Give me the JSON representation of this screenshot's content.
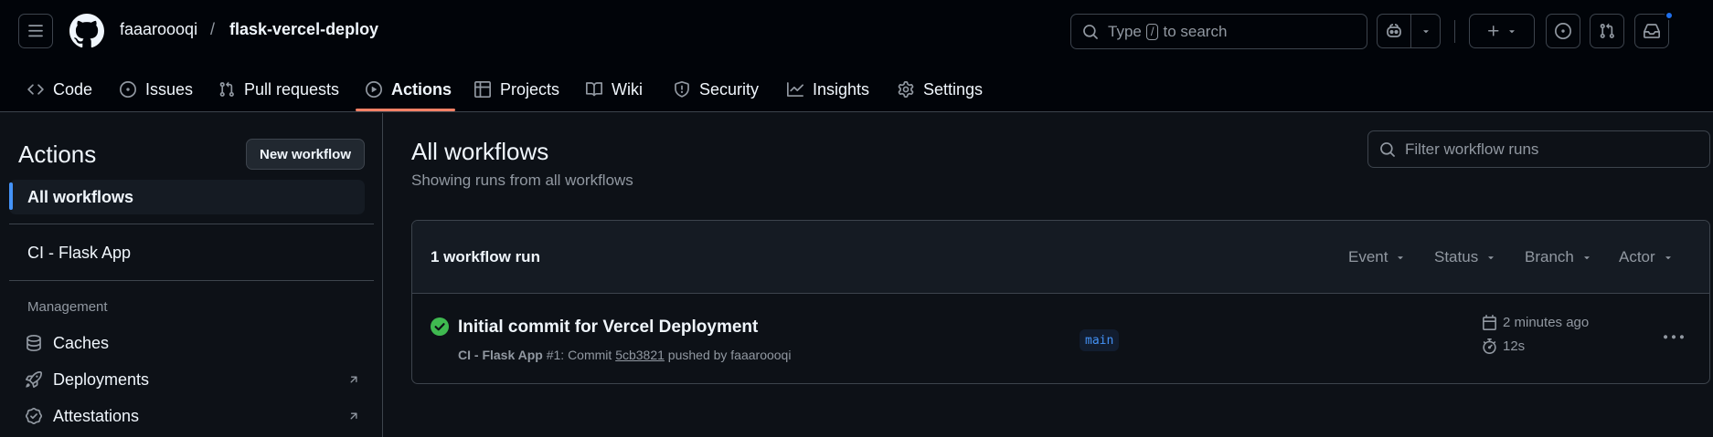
{
  "header": {
    "owner": "faaaroooqi",
    "separator": "/",
    "repo": "flask-vercel-deploy",
    "search": {
      "prefix": "Type",
      "key": "/",
      "suffix": "to search"
    }
  },
  "tabs": [
    {
      "label": "Code",
      "icon": "code-icon"
    },
    {
      "label": "Issues",
      "icon": "issue-icon"
    },
    {
      "label": "Pull requests",
      "icon": "pull-request-icon"
    },
    {
      "label": "Actions",
      "icon": "play-icon",
      "active": true
    },
    {
      "label": "Projects",
      "icon": "table-icon"
    },
    {
      "label": "Wiki",
      "icon": "book-icon"
    },
    {
      "label": "Security",
      "icon": "shield-icon"
    },
    {
      "label": "Insights",
      "icon": "graph-icon"
    },
    {
      "label": "Settings",
      "icon": "gear-icon"
    }
  ],
  "sidebar": {
    "title": "Actions",
    "new_workflow": "New workflow",
    "all_workflows": "All workflows",
    "workflows": [
      "CI - Flask App"
    ],
    "management_heading": "Management",
    "management": [
      {
        "label": "Caches",
        "icon": "database-icon",
        "external": false
      },
      {
        "label": "Deployments",
        "icon": "rocket-icon",
        "external": true
      },
      {
        "label": "Attestations",
        "icon": "verified-icon",
        "external": true
      }
    ]
  },
  "main": {
    "title": "All workflows",
    "subtitle": "Showing runs from all workflows",
    "filter_placeholder": "Filter workflow runs",
    "runs_count": "1 workflow run",
    "filters": [
      "Event",
      "Status",
      "Branch",
      "Actor"
    ],
    "runs": [
      {
        "title": "Initial commit for Vercel Deployment",
        "workflow": "CI - Flask App",
        "number": "#1",
        "commit_prefix": ": Commit",
        "sha": "5cb3821",
        "pushed_by": "pushed by faaaroooqi",
        "branch": "main",
        "time": "2 minutes ago",
        "duration": "12s",
        "status": "success"
      }
    ]
  },
  "colors": {
    "accent_underline": "#f78166",
    "link_blue": "#4493f8",
    "success_green": "#3fb950"
  }
}
